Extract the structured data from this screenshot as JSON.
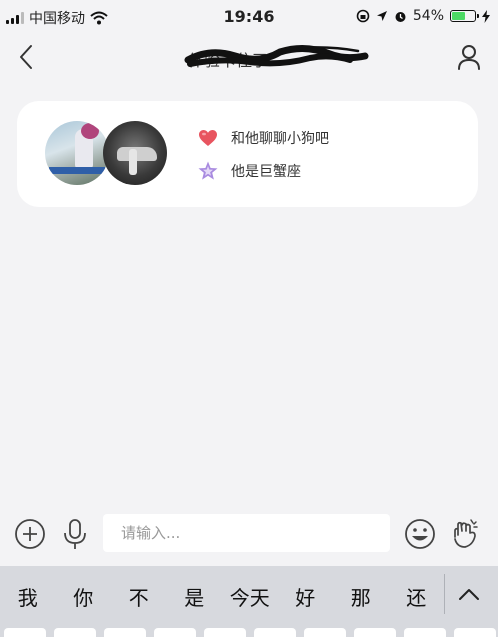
{
  "status_bar": {
    "carrier": "中国移动",
    "time": "19:46",
    "battery_percent": "54%",
    "battery_level": 0.54
  },
  "nav": {
    "title": "体验卡住了"
  },
  "card": {
    "tags": [
      {
        "icon": "heart-icon",
        "text": "和他聊聊小狗吧"
      },
      {
        "icon": "star-icon",
        "text": "他是巨蟹座"
      }
    ]
  },
  "input": {
    "placeholder": "请输入..."
  },
  "suggestions": [
    "我",
    "你",
    "不",
    "是",
    "今天",
    "好",
    "那",
    "还"
  ],
  "colors": {
    "background": "#f3f3f5",
    "battery_green": "#4cd964",
    "heart": "#e8545f",
    "star": "#a98be0",
    "keyboard": "#d7d9de"
  }
}
